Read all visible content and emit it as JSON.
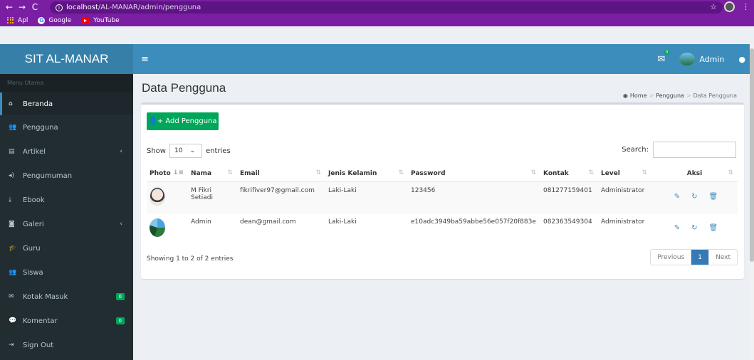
{
  "browser": {
    "url_host": "localhost",
    "url_path": "/AL-MANAR/admin/pengguna",
    "bookmarks": [
      {
        "label": "Apl"
      },
      {
        "label": "Google"
      },
      {
        "label": "YouTube"
      }
    ]
  },
  "header": {
    "brand": "SIT AL-MANAR",
    "mail_count": "0",
    "user_name": "Admin"
  },
  "sidebar": {
    "section_label": "Menu Utama",
    "items": [
      {
        "label": "Beranda",
        "icon": "home-icon",
        "glyph": "⌂"
      },
      {
        "label": "Pengguna",
        "icon": "users-icon",
        "glyph": "👥"
      },
      {
        "label": "Artikel",
        "icon": "newspaper-icon",
        "glyph": "▤"
      },
      {
        "label": "Pengumuman",
        "icon": "volume-icon",
        "glyph": "◂)"
      },
      {
        "label": "Ebook",
        "icon": "download-icon",
        "glyph": "⤓"
      },
      {
        "label": "Galeri",
        "icon": "camera-icon",
        "glyph": "◙"
      },
      {
        "label": "Guru",
        "icon": "graduation-cap-icon",
        "glyph": "🎓"
      },
      {
        "label": "Siswa",
        "icon": "users-icon",
        "glyph": "👥"
      },
      {
        "label": "Kotak Masuk",
        "icon": "envelope-icon",
        "glyph": "✉",
        "badge": "0"
      },
      {
        "label": "Komentar",
        "icon": "comments-icon",
        "glyph": "💬",
        "badge": "0"
      },
      {
        "label": "Sign Out",
        "icon": "sign-out-icon",
        "glyph": "⇥"
      }
    ]
  },
  "page": {
    "title": "Data Pengguna",
    "breadcrumb": [
      "Home",
      "Pengguna",
      "Data Pengguna"
    ]
  },
  "toolbar": {
    "add_label": "Add Pengguna",
    "show_label": "Show",
    "show_value": "10",
    "entries_label": "entries",
    "search_label": "Search:"
  },
  "table": {
    "columns": [
      "Photo",
      "Nama",
      "Email",
      "Jenis Kelamin",
      "Password",
      "Kontak",
      "Level",
      "Aksi"
    ],
    "rows": [
      {
        "nama": "M Fikri Setiadi",
        "email": "fikrifiver97@gmail.com",
        "jk": "Laki-Laki",
        "password": "123456",
        "kontak": "081277159401",
        "level": "Administrator"
      },
      {
        "nama": "Admin",
        "email": "dean@gmail.com",
        "jk": "Laki-Laki",
        "password": "e10adc3949ba59abbe56e057f20f883e",
        "kontak": "082363549304",
        "level": "Administrator"
      }
    ]
  },
  "footer": {
    "info": "Showing 1 to 2 of 2 entries",
    "prev": "Previous",
    "page": "1",
    "next": "Next"
  }
}
